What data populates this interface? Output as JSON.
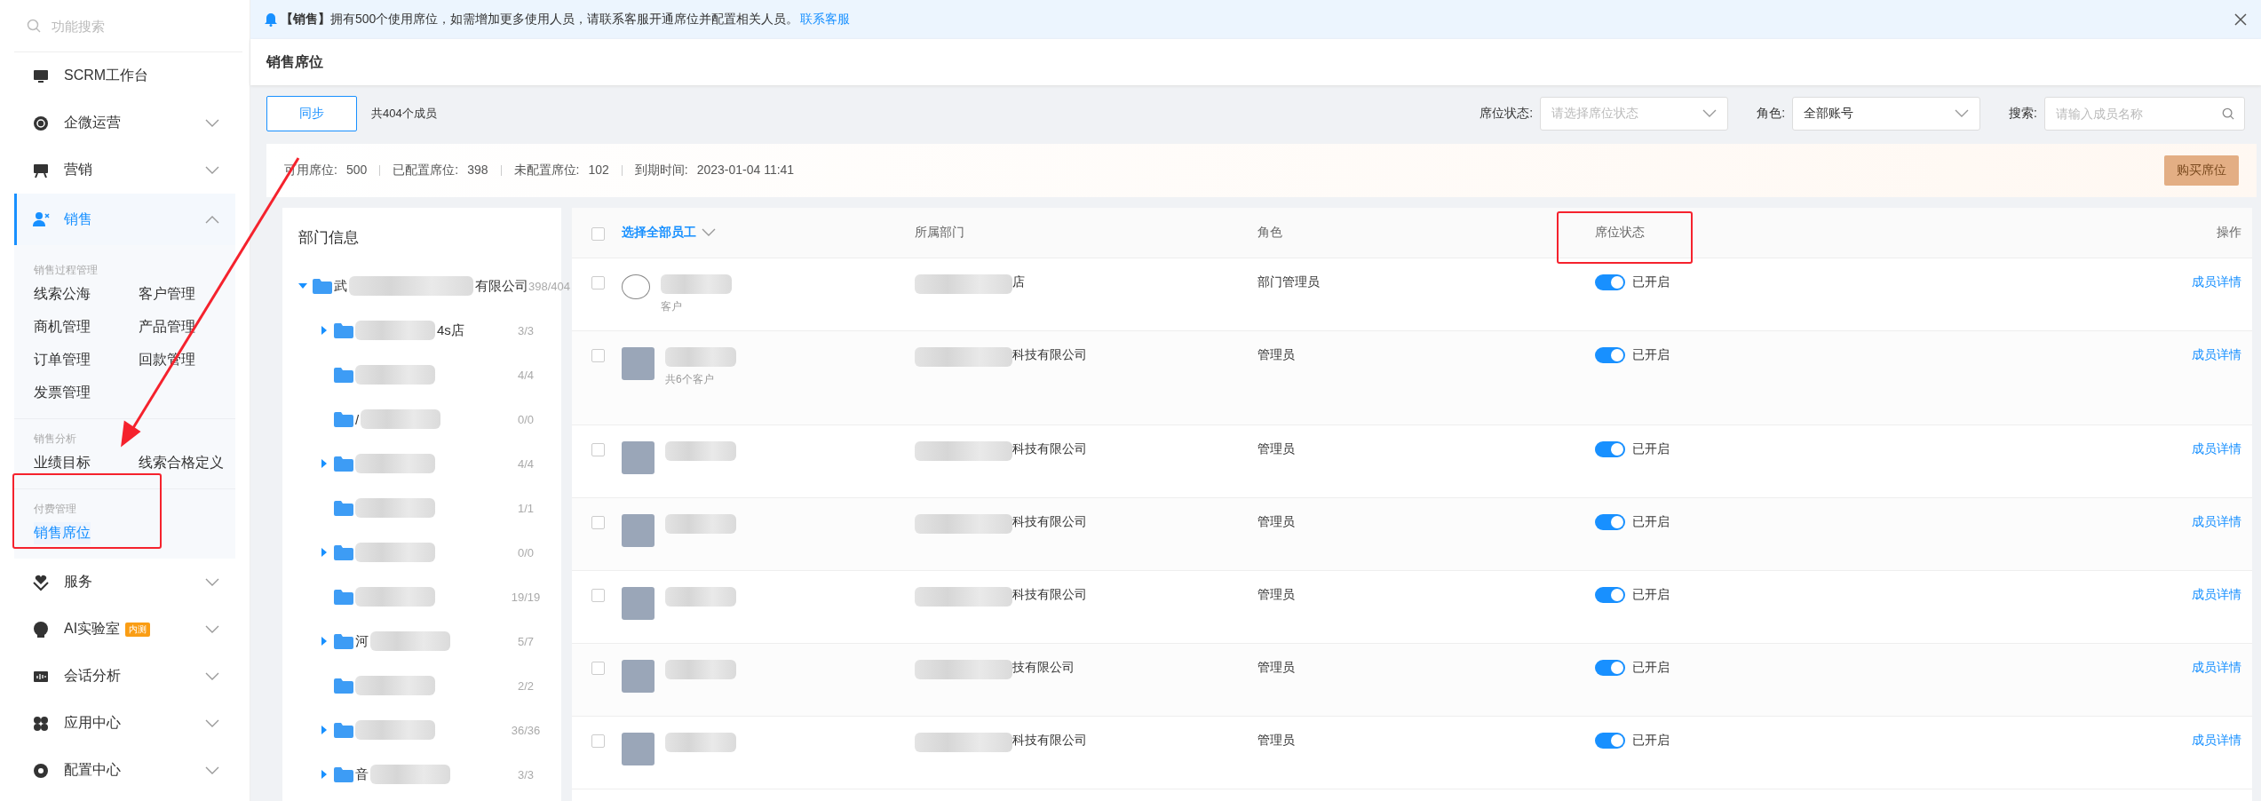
{
  "sidebar": {
    "search": {
      "placeholder": "功能搜索"
    },
    "items": [
      {
        "label": "SCRM工作台",
        "selected": false
      },
      {
        "label": "企微运营",
        "expanded": false,
        "selected": false
      },
      {
        "label": "营销",
        "expanded": false,
        "selected": false
      },
      {
        "label": "销售",
        "expanded": true,
        "selected": true,
        "groups": [
          {
            "title": "销售过程管理",
            "links": [
              {
                "label": "线索公海",
                "selected": false
              },
              {
                "label": "客户管理",
                "selected": false
              },
              {
                "label": "商机管理",
                "selected": false
              },
              {
                "label": "产品管理",
                "selected": false
              },
              {
                "label": "订单管理",
                "selected": false
              },
              {
                "label": "回款管理",
                "selected": false
              },
              {
                "label": "发票管理",
                "selected": false
              }
            ]
          },
          {
            "title": "销售分析",
            "links": [
              {
                "label": "业绩目标",
                "selected": false
              },
              {
                "label": "线索合格定义",
                "selected": false
              }
            ]
          },
          {
            "title": "付费管理",
            "links": [
              {
                "label": "销售席位",
                "selected": true
              }
            ]
          }
        ]
      },
      {
        "label": "服务",
        "expanded": false,
        "selected": false
      },
      {
        "label": "AI实验室",
        "badge": "内测",
        "expanded": false,
        "selected": false
      },
      {
        "label": "会话分析",
        "expanded": false,
        "selected": false
      },
      {
        "label": "应用中心",
        "expanded": false,
        "selected": false
      },
      {
        "label": "配置中心",
        "expanded": false,
        "selected": false
      }
    ]
  },
  "notice": {
    "text": "**【销售】**拥有500个使用席位，如需增加更多使用人员，请联系客服开通席位并配置相关人员。",
    "link": "联系客服"
  },
  "page_title": "销售席位",
  "toolbar": {
    "sync_button": "同步",
    "member_count": "共404个成员",
    "filters": [
      {
        "kind": "select",
        "label": "席位状态:",
        "placeholder": "请选择席位状态"
      },
      {
        "kind": "select",
        "label": "角色:",
        "value": "全部账号"
      },
      {
        "kind": "search",
        "label": "搜索:",
        "placeholder": "请输入成员名称"
      }
    ]
  },
  "stats": {
    "items": [
      {
        "label": "可用席位:",
        "value": "500"
      },
      {
        "label": "已配置席位:",
        "value": "398"
      },
      {
        "label": "未配置席位:",
        "value": "102"
      },
      {
        "label": "到期时间:",
        "value": "2023-01-04 11:41"
      }
    ],
    "buy_button": "购买席位"
  },
  "departments": {
    "title": "部门信息",
    "tree": [
      {
        "name_start": "武",
        "name_end": "有限公司",
        "count": "398/404",
        "expanded": true,
        "children": [
          {
            "name_end": "4s店",
            "count": "3/3",
            "expanded": false
          },
          {
            "count": "4/4"
          },
          {
            "name_start": "/",
            "count": "0/0"
          },
          {
            "count": "4/4",
            "expanded": false
          },
          {
            "count": "1/1"
          },
          {
            "count": "0/0",
            "expanded": false
          },
          {
            "count": "19/19"
          },
          {
            "name_start": "河",
            "count": "5/7",
            "expanded": false
          },
          {
            "count": "2/2"
          },
          {
            "count": "36/36",
            "expanded": false
          },
          {
            "name_start": "音",
            "count": "3/3",
            "expanded": false
          }
        ]
      }
    ]
  },
  "table": {
    "select_all": "选择全部员工",
    "select_all_checked": false,
    "columns": [
      "所属部门",
      "角色",
      "席位状态",
      "操作"
    ],
    "rows": [
      {
        "checked": false,
        "kind": "emoji",
        "member_sub": "客户",
        "dept_end": "店",
        "role": "部门管理员",
        "seat_on": true,
        "status": "已开启",
        "action": "成员详情"
      },
      {
        "checked": false,
        "kind": "photo",
        "member_sub": "共6个客户",
        "dept_end": "科技有限公司",
        "role": "管理员",
        "seat_on": true,
        "status": "已开启",
        "action": "成员详情"
      },
      {
        "checked": false,
        "kind": "photo",
        "dept_end": "科技有限公司",
        "role": "管理员",
        "seat_on": true,
        "status": "已开启",
        "action": "成员详情"
      },
      {
        "checked": false,
        "kind": "photo",
        "dept_end": "科技有限公司",
        "role": "管理员",
        "seat_on": true,
        "status": "已开启",
        "action": "成员详情"
      },
      {
        "checked": false,
        "kind": "photo",
        "dept_end": "科技有限公司",
        "role": "管理员",
        "seat_on": true,
        "status": "已开启",
        "action": "成员详情"
      },
      {
        "checked": false,
        "kind": "photo",
        "dept_end": "技有限公司",
        "role": "管理员",
        "seat_on": true,
        "status": "已开启",
        "action": "成员详情"
      },
      {
        "checked": false,
        "kind": "photo",
        "dept_end": "科技有限公司",
        "role": "管理员",
        "seat_on": true,
        "status": "已开启",
        "action": "成员详情"
      }
    ]
  }
}
